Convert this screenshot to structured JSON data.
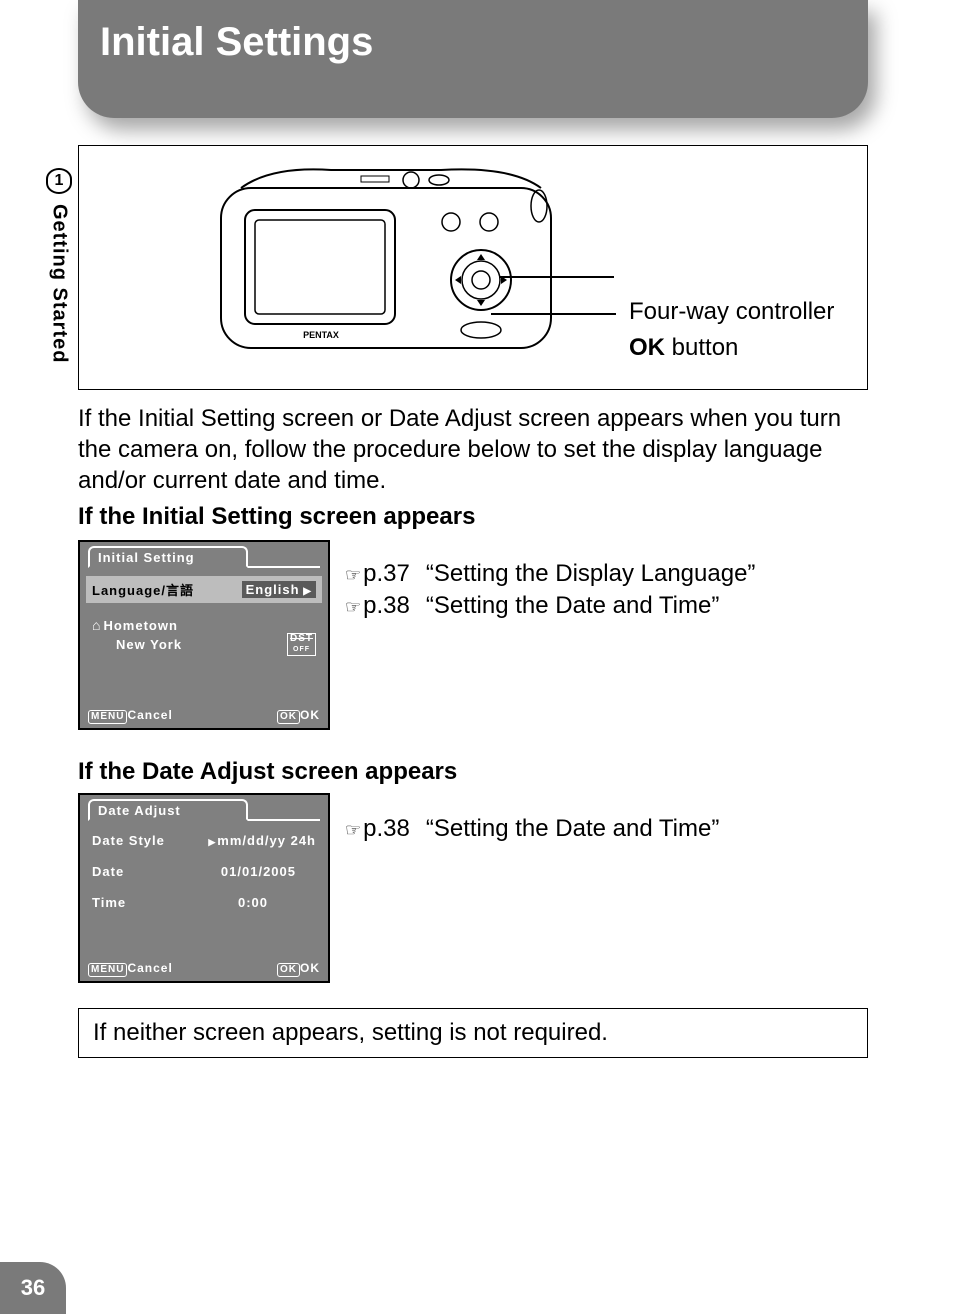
{
  "page_number": "36",
  "section": {
    "number": "1",
    "title": "Getting Started"
  },
  "header": {
    "title": "Initial Settings"
  },
  "diagram": {
    "callout1": "Four-way controller",
    "callout2_bold": "OK",
    "callout2_rest": " button",
    "brand": "PENTAX"
  },
  "intro": "If the Initial Setting screen or Date Adjust screen appears when you turn the camera on, follow the procedure below to set the display language and/or current date and time.",
  "sub1": "If the Initial Setting screen appears",
  "screen1": {
    "title": "Initial Setting",
    "lang_label": "Language/言語",
    "lang_value": "English",
    "hometown_label": "Hometown",
    "hometown_value": "New York",
    "dst_label": "DST",
    "dst_sub": "OFF",
    "menu_btn": "MENU",
    "cancel": "Cancel",
    "ok_btn": "OK",
    "ok_text": "OK"
  },
  "refs1": [
    {
      "page": "p.37",
      "title": "“Setting the Display Language”"
    },
    {
      "page": "p.38",
      "title": "“Setting the Date and Time”"
    }
  ],
  "sub2": "If the Date Adjust screen appears",
  "screen2": {
    "title": "Date Adjust",
    "style_label": "Date Style",
    "style_value": "mm/dd/yy 24h",
    "date_label": "Date",
    "date_value": "01/01/2005",
    "time_label": "Time",
    "time_value": "0:00",
    "menu_btn": "MENU",
    "cancel": "Cancel",
    "ok_btn": "OK",
    "ok_text": "OK"
  },
  "refs2": [
    {
      "page": "p.38",
      "title": "“Setting the Date and Time”"
    }
  ],
  "note": "If neither screen appears, setting is not required."
}
